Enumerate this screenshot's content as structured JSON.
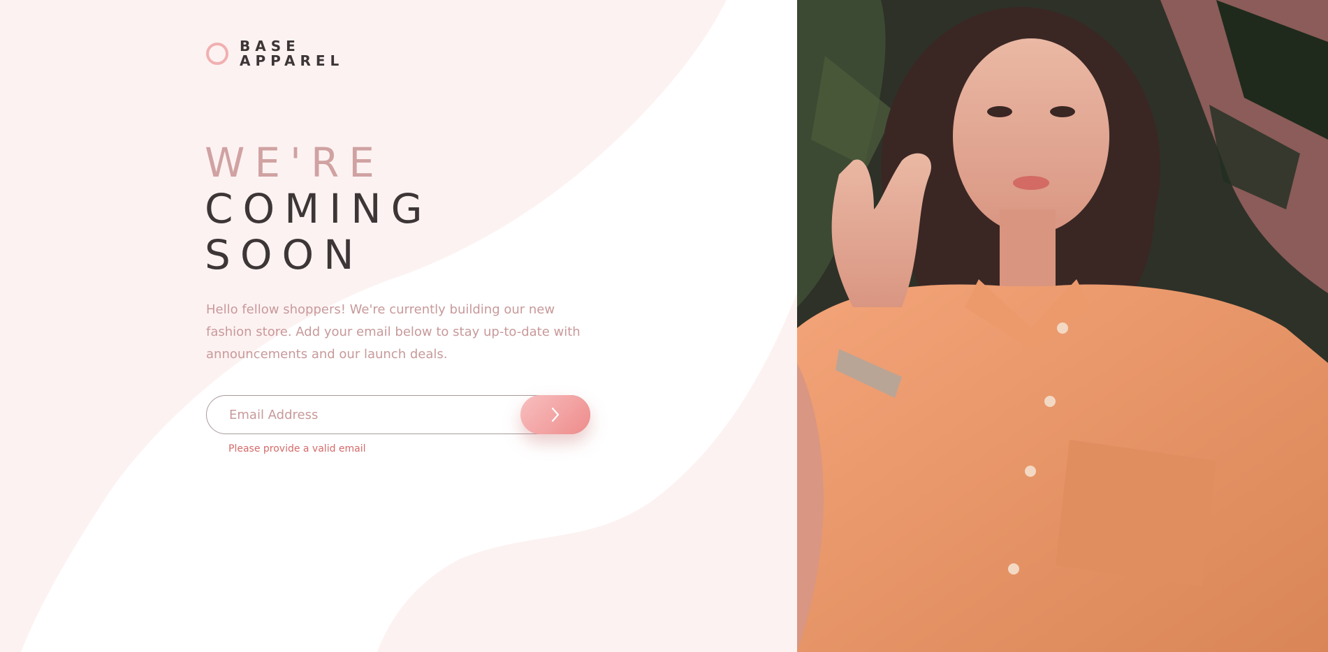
{
  "brand": {
    "line1": "BASE",
    "line2": "APPAREL"
  },
  "hero": {
    "line1": "WE'RE",
    "line2": "COMING",
    "line3": "SOON",
    "intro": "Hello fellow shoppers! We're currently building our new fashion store. Add your email below to stay up-to-date with announcements and our launch deals."
  },
  "form": {
    "email_placeholder": "Email Address",
    "email_value": "",
    "error": "Please provide a valid email",
    "submit_icon": "chevron-right-icon"
  },
  "colors": {
    "accent": "#ee8b8b",
    "heading_dark": "#3d3636",
    "text_pink": "#c8999a",
    "error": "#d56a6a"
  },
  "hero_image": {
    "icon": "model-photo"
  }
}
